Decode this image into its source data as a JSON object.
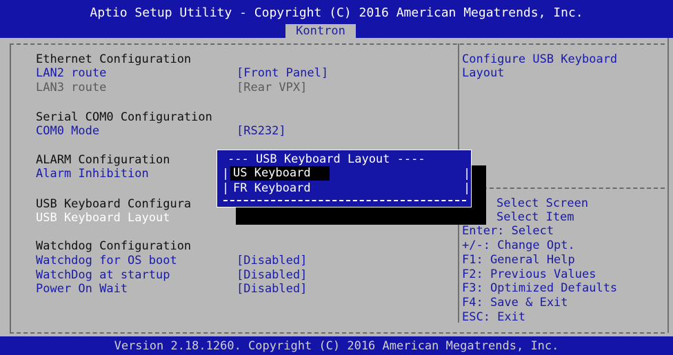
{
  "header": {
    "title": "Aptio Setup Utility - Copyright (C) 2016 American Megatrends, Inc.",
    "tab": "Kontron"
  },
  "main": {
    "ethernet_title": "Ethernet Configuration",
    "lan2_label": "LAN2 route",
    "lan2_value": "[Front Panel]",
    "lan3_label": "LAN3 route",
    "lan3_value": "[Rear VPX]",
    "serial_title": "Serial COM0 Configuration",
    "com0_label": "COM0 Mode",
    "com0_value": "[RS232]",
    "alarm_title": "ALARM Configuration",
    "alarm_label": "Alarm Inhibition",
    "usb_title": "USB Keyboard Configura",
    "usb_label": "USB Keyboard Layout",
    "watchdog_title": "Watchdog Configuration",
    "wd_os_label": "Watchdog for OS boot",
    "wd_os_value": "[Disabled]",
    "wd_start_label": "WatchDog at startup",
    "wd_start_value": "[Disabled]",
    "pow_label": "Power On Wait",
    "pow_value": "[Disabled]"
  },
  "popup": {
    "title": "--- USB Keyboard Layout ----",
    "options": [
      "US Keyboard",
      "FR Keyboard"
    ],
    "selected": "US Keyboard"
  },
  "help": {
    "line1": "Configure USB Keyboard",
    "line2": "Layout"
  },
  "keys": {
    "select_screen": "Select Screen",
    "select_item": "Select Item",
    "enter": "Enter: Select",
    "change": "+/-: Change Opt.",
    "f1": "F1: General Help",
    "f2": "F2: Previous Values",
    "f3": "F3: Optimized Defaults",
    "f4": "F4: Save & Exit",
    "esc": "ESC: Exit"
  },
  "footer": {
    "text": "Version 2.18.1260. Copyright (C) 2016 American Megatrends, Inc."
  },
  "colors": {
    "background": "#b8b8b8",
    "bar_blue": "#1414a8",
    "item_blue": "#1a1aa8",
    "highlight": "#ffffff"
  }
}
